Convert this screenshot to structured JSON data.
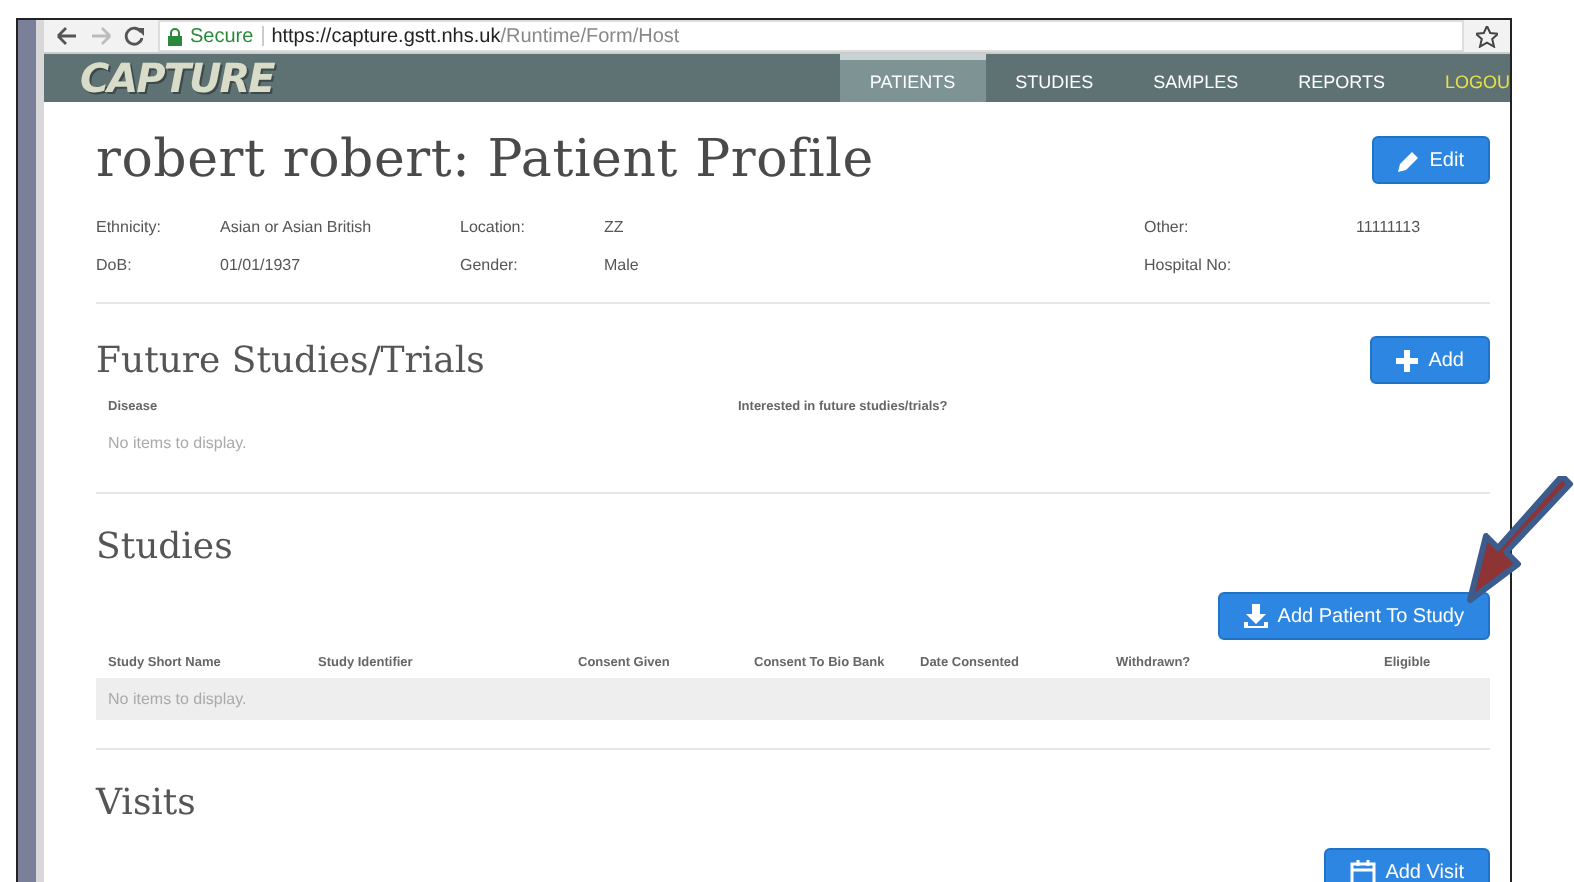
{
  "browser": {
    "secure_label": "Secure",
    "url_host": "https://capture.gstt.nhs.uk",
    "url_path": "/Runtime/Form/Host"
  },
  "nav": {
    "logo": "CAPTURE",
    "items": [
      {
        "label": "PATIENTS",
        "selected": true,
        "kind": "link"
      },
      {
        "label": "STUDIES",
        "selected": false,
        "kind": "link"
      },
      {
        "label": "SAMPLES",
        "selected": false,
        "kind": "link"
      },
      {
        "label": "REPORTS",
        "selected": false,
        "kind": "link"
      },
      {
        "label": "LOGOU",
        "selected": false,
        "kind": "logout"
      }
    ]
  },
  "profile": {
    "title": "robert robert: Patient Profile",
    "edit_button": "Edit",
    "fields": [
      {
        "label": "Ethnicity:",
        "value": "Asian or Asian British"
      },
      {
        "label": "Location:",
        "value": "ZZ"
      },
      {
        "label": "Other:",
        "value": "11111113"
      },
      {
        "label": "DoB:",
        "value": "01/01/1937"
      },
      {
        "label": "Gender:",
        "value": "Male"
      },
      {
        "label": "Hospital No:"
      }
    ]
  },
  "sections": [
    {
      "title": "Future Studies/Trials",
      "kind": "inline-action",
      "button": {
        "label": "Add"
      },
      "columns": [
        "Disease",
        "Interested in future studies/trials?"
      ],
      "empty_text": "No items to display."
    },
    {
      "title": "Studies",
      "kind": "stacked-action",
      "button": {
        "label": "Add Patient To Study"
      },
      "columns": [
        "Study Short Name",
        "Study Identifier",
        "Consent Given",
        "Consent To Bio Bank",
        "Date Consented",
        "Withdrawn?",
        "Eligible"
      ],
      "empty_text": "No items to display."
    },
    {
      "title": "Visits",
      "kind": "stacked-action",
      "button": {
        "label": "Add Visit"
      }
    }
  ]
}
